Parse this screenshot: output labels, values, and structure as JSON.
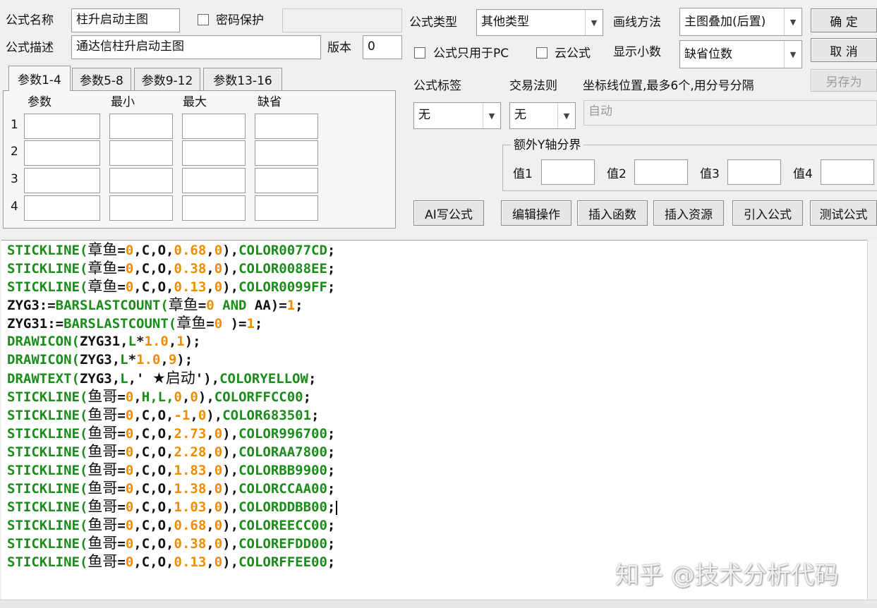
{
  "formula": {
    "name_label": "公式名称",
    "name_value": "柱升启动主图",
    "password_label": "密码保护",
    "desc_label": "公式描述",
    "desc_value": "通达信柱升启动主图",
    "version_label": "版本",
    "version_value": "0",
    "type_label": "公式类型",
    "type_value": "其他类型",
    "draw_method_label": "画线方法",
    "draw_method_value": "主图叠加(后置)",
    "pc_only_label": "公式只用于PC",
    "cloud_label": "云公式",
    "decimals_label": "显示小数",
    "decimals_value": "缺省位数",
    "tag_label": "公式标签",
    "tag_value": "无",
    "trade_rule_label": "交易法则",
    "trade_rule_value": "无",
    "axis_label": "坐标线位置,最多6个,用分号分隔",
    "axis_placeholder": "自动",
    "extra_y_label": "额外Y轴分界",
    "y_values": [
      "值1",
      "值2",
      "值3",
      "值4"
    ]
  },
  "buttons": {
    "ok": "确  定",
    "cancel": "取  消",
    "save_as": "另存为",
    "ai": "AI写公式",
    "edit_ops": "编辑操作",
    "insert_func": "插入函数",
    "insert_res": "插入资源",
    "import_formula": "引入公式",
    "test_formula": "测试公式"
  },
  "params": {
    "tabs": [
      "参数1-4",
      "参数5-8",
      "参数9-12",
      "参数13-16"
    ],
    "headers": [
      "参数",
      "最小",
      "最大",
      "缺省"
    ],
    "rows": [
      "1",
      "2",
      "3",
      "4"
    ]
  },
  "code": {
    "lines": [
      [
        [
          "fn",
          "STICKLINE("
        ],
        [
          "cn",
          "章鱼"
        ],
        [
          "op",
          "="
        ],
        [
          "num",
          "0"
        ],
        [
          "op",
          ",C,O,"
        ],
        [
          "num",
          "0.68"
        ],
        [
          "op",
          ","
        ],
        [
          "num",
          "0"
        ],
        [
          "op",
          "),"
        ],
        [
          "fn",
          "COLOR0077CD"
        ],
        [
          "op",
          ";"
        ]
      ],
      [
        [
          "fn",
          "STICKLINE("
        ],
        [
          "cn",
          "章鱼"
        ],
        [
          "op",
          "="
        ],
        [
          "num",
          "0"
        ],
        [
          "op",
          ",C,O,"
        ],
        [
          "num",
          "0.38"
        ],
        [
          "op",
          ","
        ],
        [
          "num",
          "0"
        ],
        [
          "op",
          "),"
        ],
        [
          "fn",
          "COLOR0088EE"
        ],
        [
          "op",
          ";"
        ]
      ],
      [
        [
          "fn",
          "STICKLINE("
        ],
        [
          "cn",
          "章鱼"
        ],
        [
          "op",
          "="
        ],
        [
          "num",
          "0"
        ],
        [
          "op",
          ",C,O,"
        ],
        [
          "num",
          "0.13"
        ],
        [
          "op",
          ","
        ],
        [
          "num",
          "0"
        ],
        [
          "op",
          "),"
        ],
        [
          "fn",
          "COLOR0099FF"
        ],
        [
          "op",
          ";"
        ]
      ],
      [
        [
          "var",
          "ZYG3:="
        ],
        [
          "fn",
          "BARSLASTCOUNT("
        ],
        [
          "cn",
          "章鱼"
        ],
        [
          "op",
          "="
        ],
        [
          "num",
          "0"
        ],
        [
          "fn",
          " AND "
        ],
        [
          "var",
          "AA"
        ],
        [
          "op",
          ")="
        ],
        [
          "num",
          "1"
        ],
        [
          "op",
          ";"
        ]
      ],
      [
        [
          "var",
          "ZYG31:="
        ],
        [
          "fn",
          "BARSLASTCOUNT("
        ],
        [
          "cn",
          "章鱼"
        ],
        [
          "op",
          "="
        ],
        [
          "num",
          "0"
        ],
        [
          "op",
          " )="
        ],
        [
          "num",
          "1"
        ],
        [
          "op",
          ";"
        ]
      ],
      [
        [
          "fn",
          "DRAWICON("
        ],
        [
          "var",
          "ZYG31,"
        ],
        [
          "fn",
          "L"
        ],
        [
          "op",
          "*"
        ],
        [
          "num",
          "1.0"
        ],
        [
          "op",
          ","
        ],
        [
          "num",
          "1"
        ],
        [
          "op",
          ");"
        ]
      ],
      [
        [
          "fn",
          "DRAWICON("
        ],
        [
          "var",
          "ZYG3,"
        ],
        [
          "fn",
          "L"
        ],
        [
          "op",
          "*"
        ],
        [
          "num",
          "1.0"
        ],
        [
          "op",
          ","
        ],
        [
          "num",
          "9"
        ],
        [
          "op",
          ");"
        ]
      ],
      [
        [
          "fn",
          "DRAWTEXT("
        ],
        [
          "var",
          "ZYG3,"
        ],
        [
          "fn",
          "L"
        ],
        [
          "op",
          ",' "
        ],
        [
          "cn",
          "★启动"
        ],
        [
          "op",
          "'),"
        ],
        [
          "fn",
          "COLORYELLOW"
        ],
        [
          "op",
          ";"
        ]
      ],
      [
        [
          "fn",
          "STICKLINE("
        ],
        [
          "cn",
          "鱼哥"
        ],
        [
          "op",
          "="
        ],
        [
          "num",
          "0"
        ],
        [
          "op",
          ","
        ],
        [
          "fn",
          "H,L,"
        ],
        [
          "num",
          "0"
        ],
        [
          "op",
          ","
        ],
        [
          "num",
          "0"
        ],
        [
          "op",
          "),"
        ],
        [
          "fn",
          "COLORFFCC00"
        ],
        [
          "op",
          ";"
        ]
      ],
      [
        [
          "fn",
          "STICKLINE("
        ],
        [
          "cn",
          "鱼哥"
        ],
        [
          "op",
          "="
        ],
        [
          "num",
          "0"
        ],
        [
          "op",
          ",C,O,"
        ],
        [
          "num",
          "-1"
        ],
        [
          "op",
          ","
        ],
        [
          "num",
          "0"
        ],
        [
          "op",
          "),"
        ],
        [
          "fn",
          "COLOR683501"
        ],
        [
          "op",
          ";"
        ]
      ],
      [
        [
          "fn",
          "STICKLINE("
        ],
        [
          "cn",
          "鱼哥"
        ],
        [
          "op",
          "="
        ],
        [
          "num",
          "0"
        ],
        [
          "op",
          ",C,O,"
        ],
        [
          "num",
          "2.73"
        ],
        [
          "op",
          ","
        ],
        [
          "num",
          "0"
        ],
        [
          "op",
          "),"
        ],
        [
          "fn",
          "COLOR996700"
        ],
        [
          "op",
          ";"
        ]
      ],
      [
        [
          "fn",
          "STICKLINE("
        ],
        [
          "cn",
          "鱼哥"
        ],
        [
          "op",
          "="
        ],
        [
          "num",
          "0"
        ],
        [
          "op",
          ",C,O,"
        ],
        [
          "num",
          "2.28"
        ],
        [
          "op",
          ","
        ],
        [
          "num",
          "0"
        ],
        [
          "op",
          "),"
        ],
        [
          "fn",
          "COLORAA7800"
        ],
        [
          "op",
          ";"
        ]
      ],
      [
        [
          "fn",
          "STICKLINE("
        ],
        [
          "cn",
          "鱼哥"
        ],
        [
          "op",
          "="
        ],
        [
          "num",
          "0"
        ],
        [
          "op",
          ",C,O,"
        ],
        [
          "num",
          "1.83"
        ],
        [
          "op",
          ","
        ],
        [
          "num",
          "0"
        ],
        [
          "op",
          "),"
        ],
        [
          "fn",
          "COLORBB9900"
        ],
        [
          "op",
          ";"
        ]
      ],
      [
        [
          "fn",
          "STICKLINE("
        ],
        [
          "cn",
          "鱼哥"
        ],
        [
          "op",
          "="
        ],
        [
          "num",
          "0"
        ],
        [
          "op",
          ",C,O,"
        ],
        [
          "num",
          "1.38"
        ],
        [
          "op",
          ","
        ],
        [
          "num",
          "0"
        ],
        [
          "op",
          "),"
        ],
        [
          "fn",
          "COLORCCAA00"
        ],
        [
          "op",
          ";"
        ]
      ],
      [
        [
          "fn",
          "STICKLINE("
        ],
        [
          "cn",
          "鱼哥"
        ],
        [
          "op",
          "="
        ],
        [
          "num",
          "0"
        ],
        [
          "op",
          ",C,O,"
        ],
        [
          "num",
          "1.03"
        ],
        [
          "op",
          ","
        ],
        [
          "num",
          "0"
        ],
        [
          "op",
          "),"
        ],
        [
          "fn",
          "COLORDDBB00"
        ],
        [
          "op",
          ";"
        ]
      ],
      [
        [
          "fn",
          "STICKLINE("
        ],
        [
          "cn",
          "鱼哥"
        ],
        [
          "op",
          "="
        ],
        [
          "num",
          "0"
        ],
        [
          "op",
          ",C,O,"
        ],
        [
          "num",
          "0.68"
        ],
        [
          "op",
          ","
        ],
        [
          "num",
          "0"
        ],
        [
          "op",
          "),"
        ],
        [
          "fn",
          "COLOREECC00"
        ],
        [
          "op",
          ";"
        ]
      ],
      [
        [
          "fn",
          "STICKLINE("
        ],
        [
          "cn",
          "鱼哥"
        ],
        [
          "op",
          "="
        ],
        [
          "num",
          "0"
        ],
        [
          "op",
          ",C,O,"
        ],
        [
          "num",
          "0.38"
        ],
        [
          "op",
          ","
        ],
        [
          "num",
          "0"
        ],
        [
          "op",
          "),"
        ],
        [
          "fn",
          "COLOREFDD00"
        ],
        [
          "op",
          ";"
        ]
      ],
      [
        [
          "fn",
          "STICKLINE("
        ],
        [
          "cn",
          "鱼哥"
        ],
        [
          "op",
          "="
        ],
        [
          "num",
          "0"
        ],
        [
          "op",
          ",C,O,"
        ],
        [
          "num",
          "0.13"
        ],
        [
          "op",
          ","
        ],
        [
          "num",
          "0"
        ],
        [
          "op",
          "),"
        ],
        [
          "fn",
          "COLORFFEE00"
        ],
        [
          "op",
          ";"
        ]
      ]
    ],
    "caret_line": 14
  },
  "watermark": "知乎 @技术分析代码",
  "colors": {
    "keyword": "#1a8c1a",
    "number": "#f08c00",
    "text": "#111111"
  }
}
